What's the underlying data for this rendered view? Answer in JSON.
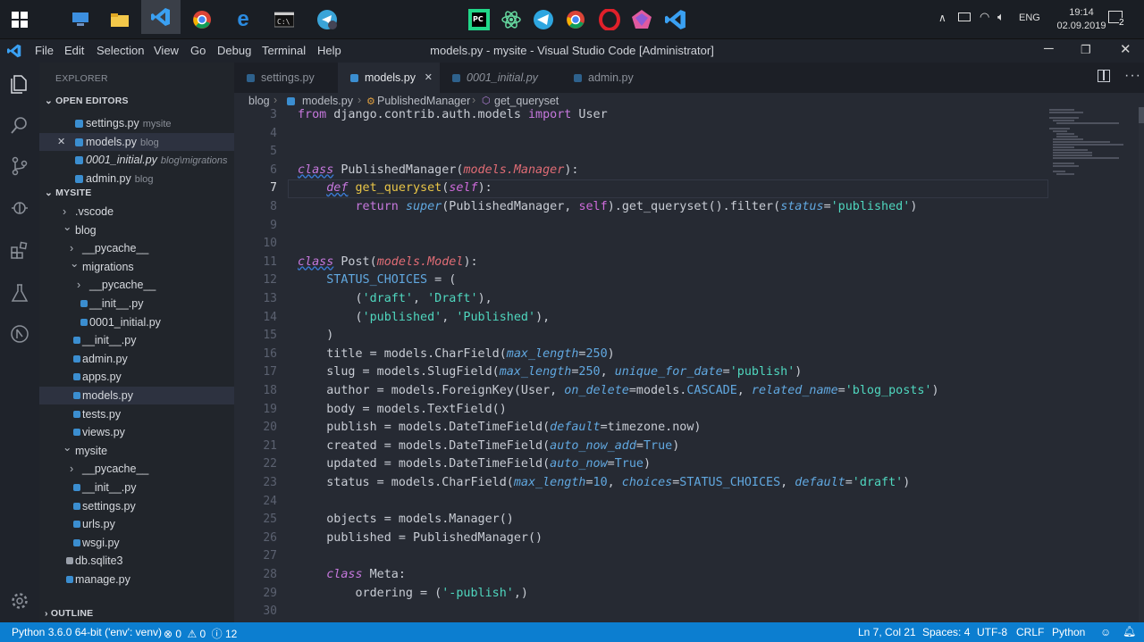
{
  "taskbar": {
    "time": "19:14",
    "date": "02.09.2019",
    "lang": "ENG",
    "notif_count": "2"
  },
  "window": {
    "title": "models.py - mysite - Visual Studio Code [Administrator]"
  },
  "menu": [
    "File",
    "Edit",
    "Selection",
    "View",
    "Go",
    "Debug",
    "Terminal",
    "Help"
  ],
  "sidebar": {
    "explorer_title": "EXPLORER",
    "open_editors_title": "OPEN EDITORS",
    "open_editors": [
      {
        "name": "settings.py",
        "dir": "mysite",
        "italic": false,
        "close": false
      },
      {
        "name": "models.py",
        "dir": "blog",
        "italic": false,
        "close": true
      },
      {
        "name": "0001_initial.py",
        "dir": "blog\\migrations",
        "italic": true,
        "close": false
      },
      {
        "name": "admin.py",
        "dir": "blog",
        "italic": false,
        "close": false
      }
    ],
    "folder_title": "MYSITE",
    "tree": [
      {
        "name": ".vscode",
        "kind": "folder-closed",
        "indent": 1
      },
      {
        "name": "blog",
        "kind": "folder-open",
        "indent": 1
      },
      {
        "name": "__pycache__",
        "kind": "folder-closed",
        "indent": 2
      },
      {
        "name": "migrations",
        "kind": "folder-open",
        "indent": 2
      },
      {
        "name": "__pycache__",
        "kind": "folder-closed",
        "indent": 3
      },
      {
        "name": "__init__.py",
        "kind": "py",
        "indent": 3
      },
      {
        "name": "0001_initial.py",
        "kind": "py",
        "indent": 3
      },
      {
        "name": "__init__.py",
        "kind": "py",
        "indent": 2
      },
      {
        "name": "admin.py",
        "kind": "py",
        "indent": 2
      },
      {
        "name": "apps.py",
        "kind": "py",
        "indent": 2
      },
      {
        "name": "models.py",
        "kind": "py",
        "indent": 2,
        "selected": true
      },
      {
        "name": "tests.py",
        "kind": "py",
        "indent": 2
      },
      {
        "name": "views.py",
        "kind": "py",
        "indent": 2
      },
      {
        "name": "mysite",
        "kind": "folder-open",
        "indent": 1
      },
      {
        "name": "__pycache__",
        "kind": "folder-closed",
        "indent": 2
      },
      {
        "name": "__init__.py",
        "kind": "py",
        "indent": 2
      },
      {
        "name": "settings.py",
        "kind": "py",
        "indent": 2
      },
      {
        "name": "urls.py",
        "kind": "py",
        "indent": 2
      },
      {
        "name": "wsgi.py",
        "kind": "py",
        "indent": 2
      },
      {
        "name": "db.sqlite3",
        "kind": "db",
        "indent": 1
      },
      {
        "name": "manage.py",
        "kind": "py",
        "indent": 1
      }
    ],
    "outline_title": "OUTLINE"
  },
  "tabs": [
    {
      "label": "settings.py",
      "active": false,
      "italic": false
    },
    {
      "label": "models.py",
      "active": true,
      "italic": false
    },
    {
      "label": "0001_initial.py",
      "active": false,
      "italic": true
    },
    {
      "label": "admin.py",
      "active": false,
      "italic": false
    }
  ],
  "breadcrumb": [
    "blog",
    "models.py",
    "PublishedManager",
    "get_queryset"
  ],
  "code": [
    {
      "n": "3",
      "t": [
        [
          "k",
          "from"
        ],
        [
          "p",
          " django.contrib.auth.models "
        ],
        [
          "k",
          "import"
        ],
        [
          "p",
          " User"
        ]
      ]
    },
    {
      "n": "4",
      "t": []
    },
    {
      "n": "5",
      "t": []
    },
    {
      "n": "6",
      "t": [
        [
          "ki",
          "class"
        ],
        [
          "p",
          " PublishedManager("
        ],
        [
          "ci",
          "models.Manager"
        ],
        [
          "p",
          "):"
        ]
      ]
    },
    {
      "n": "7",
      "t": [
        [
          "p",
          "    "
        ],
        [
          "ki",
          "def"
        ],
        [
          "p",
          " "
        ],
        [
          "f",
          "get_queryset"
        ],
        [
          "p",
          "("
        ],
        [
          "pi",
          "self"
        ],
        [
          "p",
          "):"
        ]
      ],
      "cur": true
    },
    {
      "n": "8",
      "t": [
        [
          "p",
          "        "
        ],
        [
          "k",
          "return"
        ],
        [
          "p",
          " "
        ],
        [
          "bi",
          "super"
        ],
        [
          "p",
          "(PublishedManager, "
        ],
        [
          "s",
          "self"
        ],
        [
          "p",
          ")."
        ],
        [
          "p",
          "get_queryset"
        ],
        [
          "p",
          "()."
        ],
        [
          "p",
          "filter("
        ],
        [
          "a",
          "status"
        ],
        [
          "p",
          "="
        ],
        [
          "str",
          "'published'"
        ],
        [
          "p",
          ")"
        ]
      ]
    },
    {
      "n": "9",
      "t": []
    },
    {
      "n": "10",
      "t": []
    },
    {
      "n": "11",
      "t": [
        [
          "ki",
          "class"
        ],
        [
          "p",
          " Post("
        ],
        [
          "ci",
          "models.Model"
        ],
        [
          "p",
          "):"
        ]
      ]
    },
    {
      "n": "12",
      "t": [
        [
          "p",
          "    "
        ],
        [
          "c",
          "STATUS_CHOICES"
        ],
        [
          "p",
          " = ("
        ]
      ]
    },
    {
      "n": "13",
      "t": [
        [
          "p",
          "        ("
        ],
        [
          "str",
          "'draft'"
        ],
        [
          "p",
          ", "
        ],
        [
          "str",
          "'Draft'"
        ],
        [
          "p",
          "),"
        ]
      ]
    },
    {
      "n": "14",
      "t": [
        [
          "p",
          "        ("
        ],
        [
          "str",
          "'published'"
        ],
        [
          "p",
          ", "
        ],
        [
          "str",
          "'Published'"
        ],
        [
          "p",
          "),"
        ]
      ]
    },
    {
      "n": "15",
      "t": [
        [
          "p",
          "    )"
        ]
      ]
    },
    {
      "n": "16",
      "t": [
        [
          "p",
          "    title = models.CharField("
        ],
        [
          "a",
          "max_length"
        ],
        [
          "p",
          "="
        ],
        [
          "num",
          "250"
        ],
        [
          "p",
          ")"
        ]
      ]
    },
    {
      "n": "17",
      "t": [
        [
          "p",
          "    slug = models.SlugField("
        ],
        [
          "a",
          "max_length"
        ],
        [
          "p",
          "="
        ],
        [
          "num",
          "250"
        ],
        [
          "p",
          ", "
        ],
        [
          "a",
          "unique_for_date"
        ],
        [
          "p",
          "="
        ],
        [
          "str",
          "'publish'"
        ],
        [
          "p",
          ")"
        ]
      ]
    },
    {
      "n": "18",
      "t": [
        [
          "p",
          "    author = models.ForeignKey(User, "
        ],
        [
          "a",
          "on_delete"
        ],
        [
          "p",
          "=models."
        ],
        [
          "c",
          "CASCADE"
        ],
        [
          "p",
          ", "
        ],
        [
          "a",
          "related_name"
        ],
        [
          "p",
          "="
        ],
        [
          "str",
          "'blog_posts'"
        ],
        [
          "p",
          ")"
        ]
      ]
    },
    {
      "n": "19",
      "t": [
        [
          "p",
          "    body = models.TextField()"
        ]
      ]
    },
    {
      "n": "20",
      "t": [
        [
          "p",
          "    publish = models.DateTimeField("
        ],
        [
          "a",
          "default"
        ],
        [
          "p",
          "=timezone.now)"
        ]
      ]
    },
    {
      "n": "21",
      "t": [
        [
          "p",
          "    created = models.DateTimeField("
        ],
        [
          "a",
          "auto_now_add"
        ],
        [
          "p",
          "="
        ],
        [
          "c",
          "True"
        ],
        [
          "p",
          ")"
        ]
      ]
    },
    {
      "n": "22",
      "t": [
        [
          "p",
          "    updated = models.DateTimeField("
        ],
        [
          "a",
          "auto_now"
        ],
        [
          "p",
          "="
        ],
        [
          "c",
          "True"
        ],
        [
          "p",
          ")"
        ]
      ]
    },
    {
      "n": "23",
      "t": [
        [
          "p",
          "    status = models.CharField("
        ],
        [
          "a",
          "max_length"
        ],
        [
          "p",
          "="
        ],
        [
          "num",
          "10"
        ],
        [
          "p",
          ", "
        ],
        [
          "a",
          "choices"
        ],
        [
          "p",
          "="
        ],
        [
          "c",
          "STATUS_CHOICES"
        ],
        [
          "p",
          ", "
        ],
        [
          "a",
          "default"
        ],
        [
          "p",
          "="
        ],
        [
          "str",
          "'draft'"
        ],
        [
          "p",
          ")"
        ]
      ]
    },
    {
      "n": "24",
      "t": []
    },
    {
      "n": "25",
      "t": [
        [
          "p",
          "    objects = models.Manager()"
        ]
      ]
    },
    {
      "n": "26",
      "t": [
        [
          "p",
          "    published = PublishedManager()"
        ]
      ]
    },
    {
      "n": "27",
      "t": []
    },
    {
      "n": "28",
      "t": [
        [
          "p",
          "    "
        ],
        [
          "ki",
          "class"
        ],
        [
          "p",
          " Meta:"
        ]
      ]
    },
    {
      "n": "29",
      "t": [
        [
          "p",
          "        ordering = ("
        ],
        [
          "str",
          "'-publish'"
        ],
        [
          "p",
          ",)"
        ]
      ]
    },
    {
      "n": "30",
      "t": []
    }
  ],
  "status": {
    "interpreter": "Python 3.6.0 64-bit ('env': venv)",
    "errors": "0",
    "warnings": "0",
    "infos": "12",
    "position": "Ln 7, Col 21",
    "spaces": "Spaces: 4",
    "encoding": "UTF-8",
    "eol": "CRLF",
    "language": "Python"
  },
  "colors": {
    "accent": "#0c7ed0",
    "keyword": "#c678dd",
    "function": "#e8c547",
    "string": "#4fd6be",
    "param": "#cf6bdb",
    "attr": "#61a8e0",
    "class_ref": "#e06c75"
  }
}
